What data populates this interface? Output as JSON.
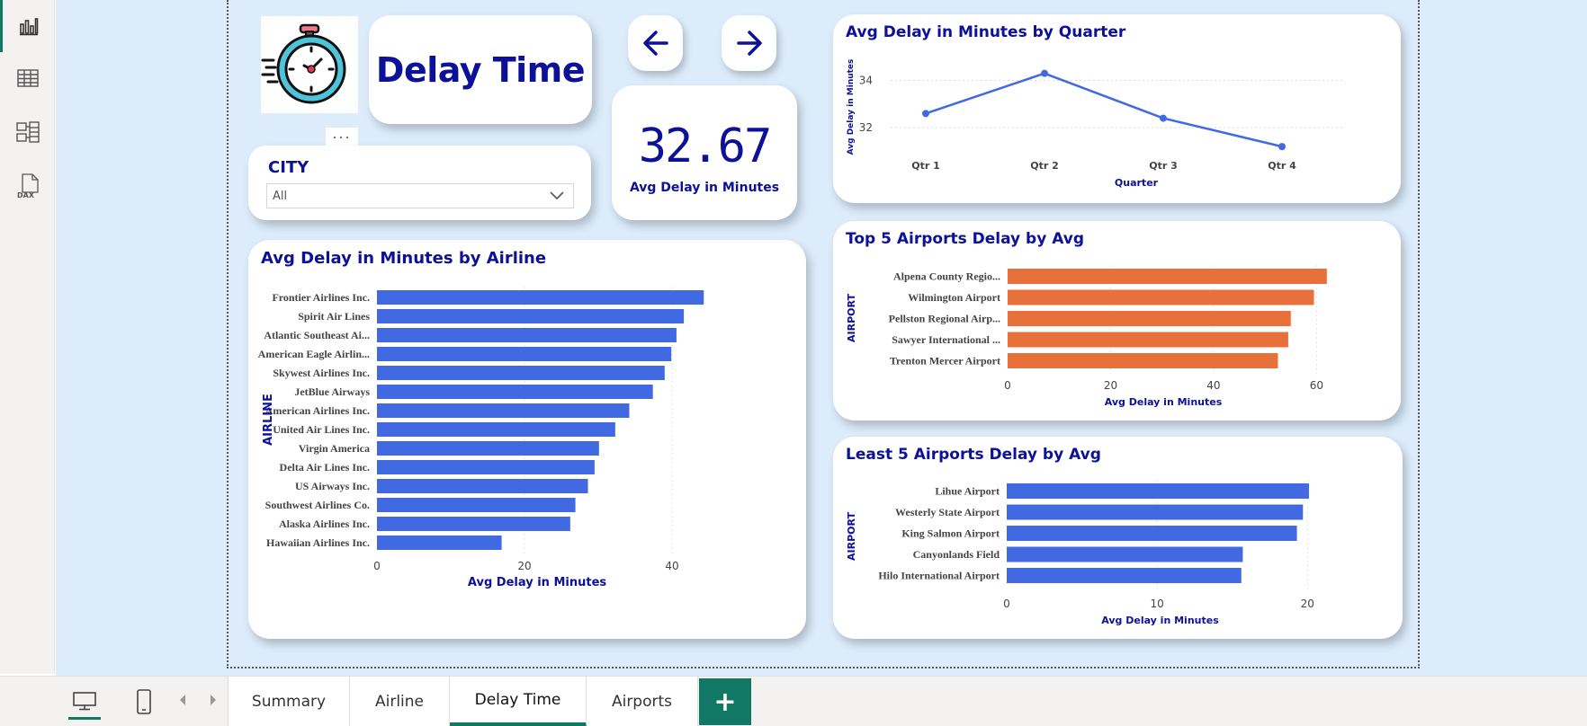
{
  "report": {
    "title": "Delay Time",
    "kpi": {
      "value": "32.67",
      "label": "Avg Delay in Minutes"
    },
    "slicer": {
      "label": "CITY",
      "selected": "All"
    }
  },
  "colors": {
    "accent": "#0c1198",
    "bar_blue": "#4169e1",
    "bar_orange": "#e8703a",
    "tab_green": "#117865"
  },
  "icons": {
    "leftbar": [
      "report-view-icon",
      "table-view-icon",
      "model-view-icon",
      "dax-query-icon"
    ],
    "nav": [
      "arrow-left-icon",
      "arrow-right-icon"
    ]
  },
  "dax_label": "DAX",
  "more_dots": "...",
  "tabs": [
    {
      "label": "Summary",
      "active": false
    },
    {
      "label": "Airline",
      "active": false
    },
    {
      "label": "Delay Time",
      "active": true
    },
    {
      "label": "Airports",
      "active": false
    }
  ],
  "add_tab_label": "+",
  "chart_data": [
    {
      "id": "airline",
      "type": "bar",
      "orientation": "horizontal",
      "title": "Avg Delay in Minutes by Airline",
      "xlabel": "Avg Delay in Minutes",
      "ylabel": "AIRLINE",
      "categories": [
        "Frontier Airlines Inc.",
        "Spirit Air Lines",
        "Atlantic Southeast Ai...",
        "American Eagle Airlin...",
        "Skywest Airlines Inc.",
        "JetBlue Airways",
        "American Airlines Inc.",
        "United Air Lines Inc.",
        "Virgin America",
        "Delta Air Lines Inc.",
        "US Airways Inc.",
        "Southwest Airlines Co.",
        "Alaska Airlines Inc.",
        "Hawaiian Airlines Inc."
      ],
      "values": [
        44.3,
        41.6,
        40.6,
        39.9,
        39.0,
        37.4,
        34.2,
        32.3,
        30.1,
        29.5,
        28.6,
        26.9,
        26.2,
        16.9
      ],
      "xlim": [
        0,
        50
      ],
      "xticks": [
        0,
        20,
        40
      ],
      "color": "#4169e1",
      "grid": true
    },
    {
      "id": "quarter",
      "type": "line",
      "title": "Avg Delay in Minutes by Quarter",
      "xlabel": "Quarter",
      "ylabel": "Avg Delay in Minutes",
      "categories": [
        "Qtr 1",
        "Qtr 2",
        "Qtr 3",
        "Qtr 4"
      ],
      "values": [
        32.6,
        34.3,
        32.4,
        31.2
      ],
      "ylim": [
        30.9,
        35.2
      ],
      "yticks": [
        32,
        34
      ],
      "color": "#4169e1",
      "grid": true
    },
    {
      "id": "top5",
      "type": "bar",
      "orientation": "horizontal",
      "title": "Top 5 Airports Delay by Avg",
      "xlabel": "Avg Delay in Minutes",
      "ylabel": "AIRPORT",
      "categories": [
        "Alpena County Regio...",
        "Wilmington Airport",
        "Pellston Regional Airp...",
        "Sawyer International ...",
        "Trenton Mercer Airport"
      ],
      "values": [
        62.0,
        59.5,
        55.0,
        54.5,
        52.5
      ],
      "xlim": [
        0,
        65
      ],
      "xticks": [
        0,
        20,
        40,
        60
      ],
      "color": "#e8703a",
      "grid": true
    },
    {
      "id": "least5",
      "type": "bar",
      "orientation": "horizontal",
      "title": "Least 5 Airports Delay by Avg",
      "xlabel": "Avg Delay in Minutes",
      "ylabel": "AIRPORT",
      "categories": [
        "Lihue Airport",
        "Westerly State Airport",
        "King Salmon Airport",
        "Canyonlands Field",
        "Hilo International Airport"
      ],
      "values": [
        20.1,
        19.7,
        19.3,
        15.7,
        15.6
      ],
      "xlim": [
        0,
        21
      ],
      "xticks": [
        0,
        10,
        20
      ],
      "color": "#4169e1",
      "grid": true
    }
  ]
}
